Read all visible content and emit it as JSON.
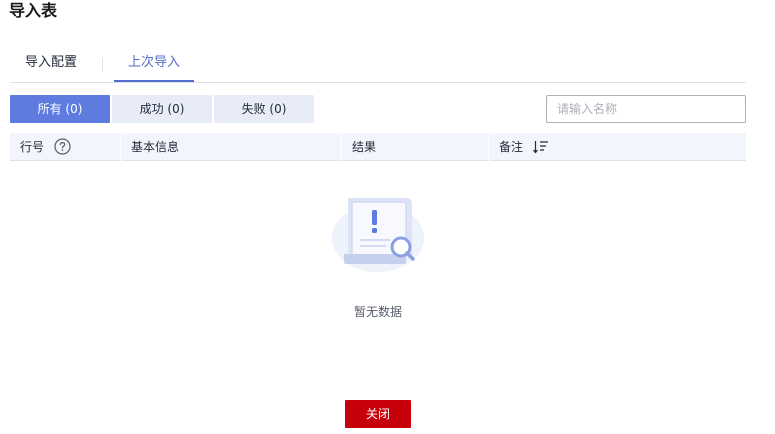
{
  "title": "导入表",
  "tabs": [
    {
      "label": "导入配置",
      "active": false
    },
    {
      "label": "上次导入",
      "active": true
    }
  ],
  "filters": [
    {
      "label": "所有 (0)",
      "active": true
    },
    {
      "label": "成功 (0)",
      "active": false
    },
    {
      "label": "失败 (0)",
      "active": false
    }
  ],
  "search": {
    "placeholder": "请输入名称",
    "value": ""
  },
  "table": {
    "columns": [
      {
        "label": "行号",
        "icon": "help-circle-icon"
      },
      {
        "label": "基本信息"
      },
      {
        "label": "结果"
      },
      {
        "label": "备注",
        "icon": "sort-icon"
      }
    ],
    "rows": []
  },
  "empty": {
    "text": "暂无数据",
    "icon": "empty-document-search-illustration"
  },
  "footer": {
    "close_label": "关闭"
  },
  "colors": {
    "accent": "#5e7ce0",
    "tab_active": "#526ecc",
    "filter_inactive_bg": "#e8ecf8",
    "header_bg": "#f2f5fc",
    "danger": "#c7000b"
  }
}
